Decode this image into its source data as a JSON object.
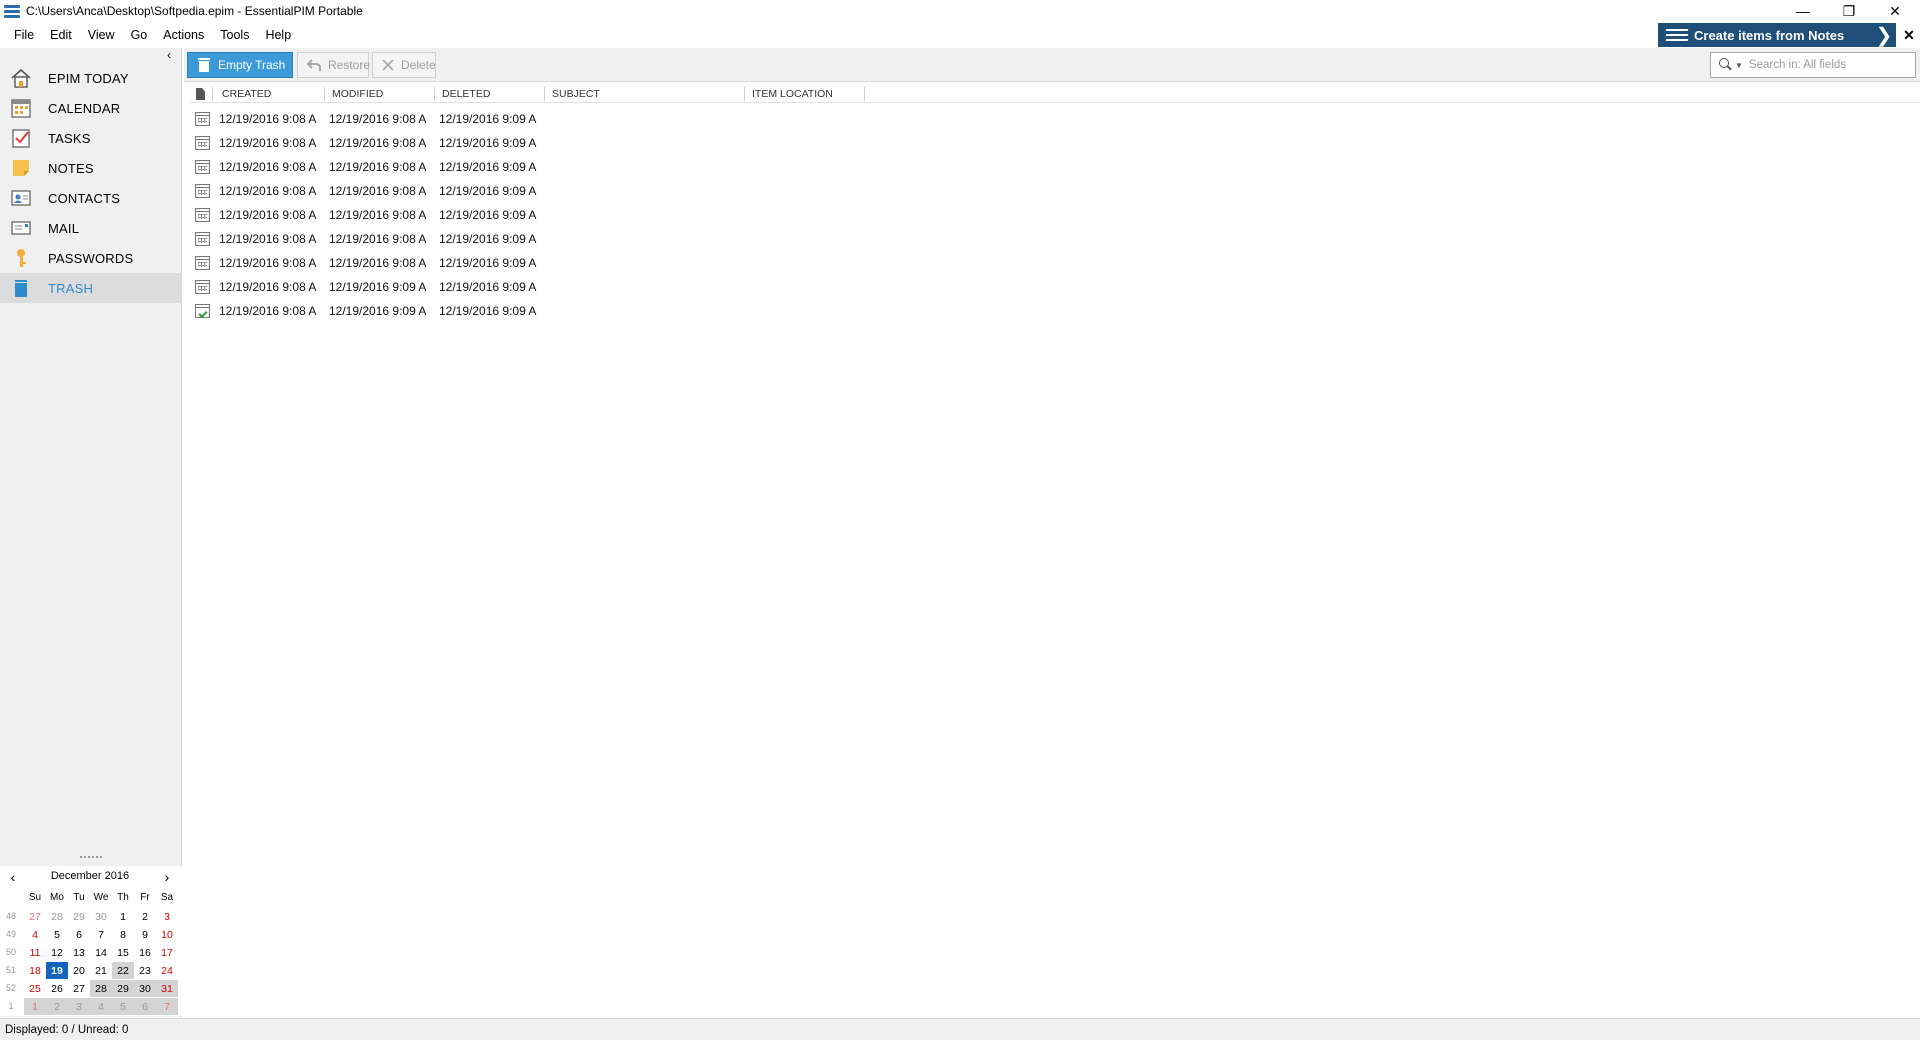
{
  "window": {
    "title": "C:\\Users\\Anca\\Desktop\\Softpedia.epim - EssentialPIM Portable",
    "controls": {
      "minimize": "—",
      "restore": "❐",
      "close": "✕"
    }
  },
  "menu": [
    "File",
    "Edit",
    "View",
    "Go",
    "Actions",
    "Tools",
    "Help"
  ],
  "banner": {
    "label": "Create items from Notes",
    "arrow": "❯",
    "close": "✕"
  },
  "sidebar": {
    "collapse": "‹",
    "items": [
      {
        "label": "EPIM TODAY",
        "icon": "home-icon",
        "active": false
      },
      {
        "label": "CALENDAR",
        "icon": "calendar-icon",
        "active": false
      },
      {
        "label": "TASKS",
        "icon": "tasks-icon",
        "active": false
      },
      {
        "label": "NOTES",
        "icon": "notes-icon",
        "active": false
      },
      {
        "label": "CONTACTS",
        "icon": "contacts-icon",
        "active": false
      },
      {
        "label": "MAIL",
        "icon": "mail-icon",
        "active": false
      },
      {
        "label": "PASSWORDS",
        "icon": "key-icon",
        "active": false
      },
      {
        "label": "TRASH",
        "icon": "trash-icon",
        "active": true
      }
    ]
  },
  "calendar": {
    "month": "December",
    "year": "2016",
    "prev": "‹",
    "next": "›",
    "weekdays": [
      "Su",
      "Mo",
      "Tu",
      "We",
      "Th",
      "Fr",
      "Sa"
    ],
    "weeks": [
      {
        "num": "48",
        "days": [
          "27",
          "28",
          "29",
          "30",
          "1",
          "2",
          "3"
        ]
      },
      {
        "num": "49",
        "days": [
          "4",
          "5",
          "6",
          "7",
          "8",
          "9",
          "10"
        ]
      },
      {
        "num": "50",
        "days": [
          "11",
          "12",
          "13",
          "14",
          "15",
          "16",
          "17"
        ]
      },
      {
        "num": "51",
        "days": [
          "18",
          "19",
          "20",
          "21",
          "22",
          "23",
          "24"
        ]
      },
      {
        "num": "52",
        "days": [
          "25",
          "26",
          "27",
          "28",
          "29",
          "30",
          "31"
        ]
      },
      {
        "num": "1",
        "days": [
          "1",
          "2",
          "3",
          "4",
          "5",
          "6",
          "7"
        ]
      }
    ],
    "today": "19"
  },
  "toolbar": {
    "empty_trash": "Empty Trash",
    "restore": "Restore",
    "delete": "Delete"
  },
  "search": {
    "placeholder": "Search in: All fields"
  },
  "grid": {
    "columns": [
      "CREATED",
      "MODIFIED",
      "DELETED",
      "SUBJECT",
      "ITEM LOCATION"
    ],
    "rows": [
      {
        "type": "calendar",
        "created": "12/19/2016 9:08 A",
        "modified": "12/19/2016 9:08 A",
        "deleted": "12/19/2016 9:09 A",
        "subject": "",
        "location": ""
      },
      {
        "type": "calendar",
        "created": "12/19/2016 9:08 A",
        "modified": "12/19/2016 9:08 A",
        "deleted": "12/19/2016 9:09 A",
        "subject": "",
        "location": ""
      },
      {
        "type": "calendar",
        "created": "12/19/2016 9:08 A",
        "modified": "12/19/2016 9:08 A",
        "deleted": "12/19/2016 9:09 A",
        "subject": "",
        "location": ""
      },
      {
        "type": "calendar",
        "created": "12/19/2016 9:08 A",
        "modified": "12/19/2016 9:08 A",
        "deleted": "12/19/2016 9:09 A",
        "subject": "",
        "location": ""
      },
      {
        "type": "calendar",
        "created": "12/19/2016 9:08 A",
        "modified": "12/19/2016 9:08 A",
        "deleted": "12/19/2016 9:09 A",
        "subject": "",
        "location": ""
      },
      {
        "type": "calendar",
        "created": "12/19/2016 9:08 A",
        "modified": "12/19/2016 9:08 A",
        "deleted": "12/19/2016 9:09 A",
        "subject": "",
        "location": ""
      },
      {
        "type": "calendar",
        "created": "12/19/2016 9:08 A",
        "modified": "12/19/2016 9:08 A",
        "deleted": "12/19/2016 9:09 A",
        "subject": "",
        "location": ""
      },
      {
        "type": "calendar",
        "created": "12/19/2016 9:08 A",
        "modified": "12/19/2016 9:09 A",
        "deleted": "12/19/2016 9:09 A",
        "subject": "",
        "location": ""
      },
      {
        "type": "task",
        "created": "12/19/2016 9:08 A",
        "modified": "12/19/2016 9:09 A",
        "deleted": "12/19/2016 9:09 A",
        "subject": "",
        "location": ""
      }
    ]
  },
  "status": "Displayed: 0 / Unread: 0",
  "colors": {
    "accent": "#2e8bc9",
    "banner": "#1f4e79",
    "button": "#3c9ad8",
    "weekend": "#d40000",
    "today": "#1565c0"
  }
}
